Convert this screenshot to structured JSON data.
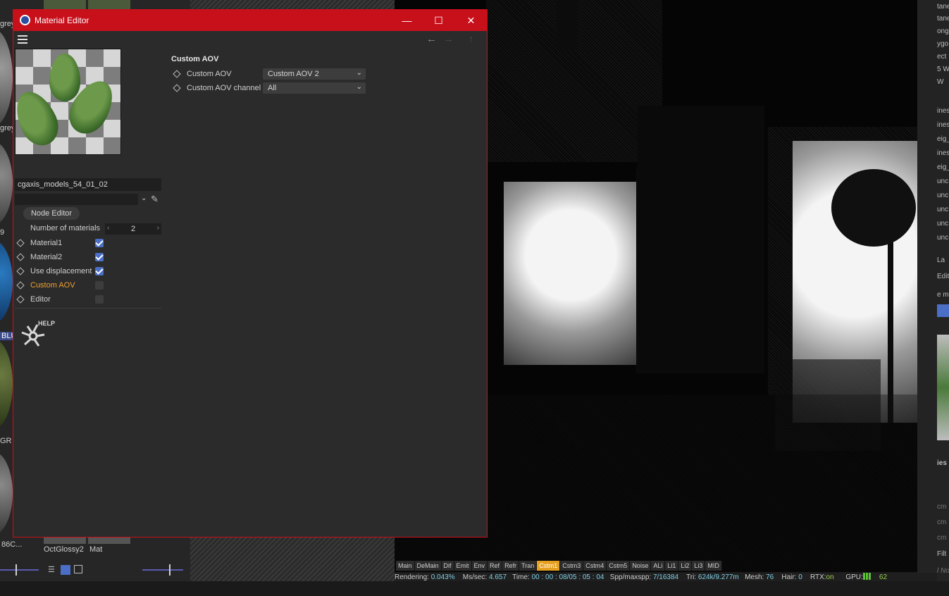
{
  "window": {
    "title": "Material Editor",
    "minimize": "—",
    "maximize": "☐",
    "close": "✕"
  },
  "nav": {
    "back": "←",
    "forward": "→",
    "up": "↑"
  },
  "material": {
    "name": "cgaxis_models_54_01_02",
    "node_editor_label": "Node Editor",
    "number_of_materials_label": "Number of materials",
    "number_of_materials_value": "2",
    "properties": [
      {
        "label": "Material1",
        "checked": true,
        "highlight": false
      },
      {
        "label": "Material2",
        "checked": true,
        "highlight": false
      },
      {
        "label": "Use displacement",
        "checked": true,
        "highlight": false
      },
      {
        "label": "Custom AOV",
        "checked": false,
        "highlight": true
      },
      {
        "label": "Editor",
        "checked": false,
        "highlight": false
      }
    ],
    "help_label": "HELP"
  },
  "custom_aov": {
    "heading": "Custom AOV",
    "aov_label": "Custom AOV",
    "aov_value": "Custom AOV 2",
    "channel_label": "Custom AOV channel",
    "channel_value": "All"
  },
  "material_manager": {
    "labels": [
      "grey",
      "grey",
      "9",
      "BLU",
      "GR",
      "86C...",
      "OctGlossy2",
      "Mat"
    ]
  },
  "aov_tabs": [
    {
      "label": "Main",
      "active": false
    },
    {
      "label": "DeMain",
      "active": false
    },
    {
      "label": "Dif",
      "active": false
    },
    {
      "label": "Emit",
      "active": false
    },
    {
      "label": "Env",
      "active": false
    },
    {
      "label": "Ref",
      "active": false
    },
    {
      "label": "Refr",
      "active": false
    },
    {
      "label": "Tran",
      "active": false
    },
    {
      "label": "Cstm1",
      "active": true
    },
    {
      "label": "Cstm3",
      "active": false
    },
    {
      "label": "Cstm4",
      "active": false
    },
    {
      "label": "Cstm5",
      "active": false
    },
    {
      "label": "Noise",
      "active": false
    },
    {
      "label": "ALi",
      "active": false
    },
    {
      "label": "Li1",
      "active": false
    },
    {
      "label": "Li2",
      "active": false
    },
    {
      "label": "Li3",
      "active": false
    },
    {
      "label": "MID",
      "active": false
    }
  ],
  "status": {
    "rendering_label": "Rendering:",
    "rendering_value": "0.043%",
    "mssec_label": "Ms/sec:",
    "mssec_value": "4.657",
    "time_label": "Time:",
    "time_value": "00 : 00 : 08/05 : 05 : 04",
    "spp_label": "Spp/maxspp:",
    "spp_value": "7/16384",
    "tri_label": "Tri:",
    "tri_value": "624k/9.277m",
    "mesh_label": "Mesh:",
    "mesh_value": "76",
    "hair_label": "Hair:",
    "hair_value": "0",
    "rtx_label": "RTX:",
    "rtx_value": "on",
    "gpu_label": "GPU:",
    "gpu_value": "62"
  },
  "right_panel": {
    "labels": [
      "tane",
      "tane",
      "ong",
      "ygo",
      "ect",
      "5 W",
      "W",
      "ines",
      "ines",
      "eig_",
      "ines",
      "eig_",
      "unc",
      "unc",
      "unc",
      "unc",
      "unc",
      "La",
      "Edit",
      "e m",
      "ies",
      "cm",
      "cm",
      "cm",
      "Filt",
      "l No"
    ]
  },
  "colors": {
    "titlebar": "#c8101b",
    "accent_orange": "#f0a030",
    "checkbox_on": "#4b6fc6",
    "status_cyan": "#7fd0e8",
    "gpu_green": "#5bc236"
  },
  "icons": [
    "hamburger-menu-icon",
    "back-arrow-icon",
    "forward-arrow-icon",
    "up-arrow-icon",
    "color-picker-icon",
    "octane-logo-icon",
    "cinema4d-icon"
  ]
}
